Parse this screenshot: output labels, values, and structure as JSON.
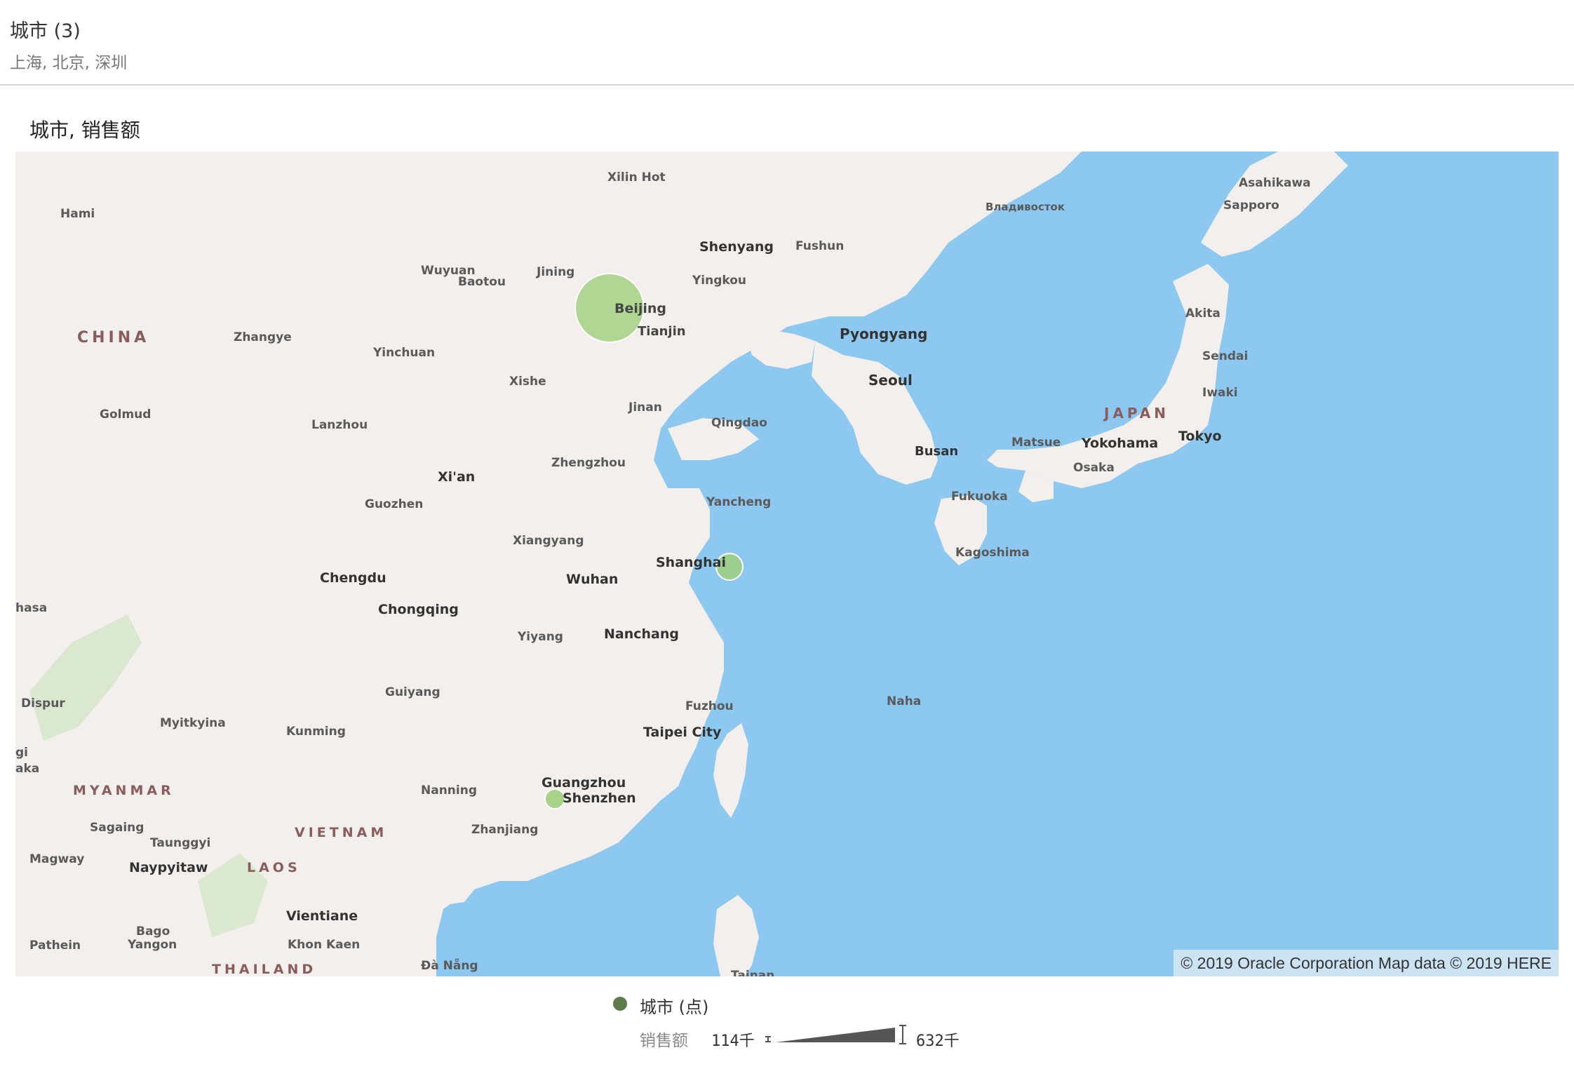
{
  "filter": {
    "title": "城市 (3)",
    "values": "上海, 北京, 深圳"
  },
  "viz": {
    "title": "城市, 销售额"
  },
  "map": {
    "copyright": "© 2019 Oracle Corporation   Map data © 2019 HERE",
    "colors": {
      "water": "#8cc8ef",
      "land": "#f2efec",
      "bubble": "#9fcf7e",
      "bubble_stroke": "#ffffff"
    },
    "bubbles": [
      {
        "city": "北京",
        "map_label": "Beijing",
        "lon": 116.4,
        "lat": 39.9
      },
      {
        "city": "上海",
        "map_label": "Shanghai",
        "lon": 121.5,
        "lat": 31.2
      },
      {
        "city": "深圳",
        "map_label": "Shenzhen",
        "lon": 114.1,
        "lat": 22.5
      }
    ],
    "country_labels": [
      "CHINA",
      "JAPAN",
      "MYANMAR",
      "VIETNAM",
      "LAOS",
      "THAILAND"
    ],
    "city_labels": [
      "Xilin Hot",
      "Hami",
      "Shenyang",
      "Fushun",
      "Владивосток",
      "Asahikawa",
      "Sapporo",
      "Wuyuan",
      "Jining",
      "Baotou",
      "Yingkou",
      "Beijing",
      "Tianjin",
      "Pyongyang",
      "Akita",
      "Zhangye",
      "Yinchuan",
      "Xishe",
      "Seoul",
      "Sendai",
      "Golmud",
      "Jinan",
      "Qingdao",
      "Lanzhou",
      "Iwaki",
      "Matsue",
      "Yokohama",
      "Tokyo",
      "Busan",
      "Osaka",
      "Xi'an",
      "Zhengzhou",
      "Fukuoka",
      "Guozhen",
      "Yancheng",
      "Xiangyang",
      "Kagoshima",
      "Shanghai",
      "Chengdu",
      "Wuhan",
      "hasa",
      "Chongqing",
      "Yiyang",
      "Nanchang",
      "Dispur",
      "Guiyang",
      "Naha",
      "Fuzhou",
      "Myitkyina",
      "Kunming",
      "Taipei City",
      "gi",
      "aka",
      "Guangzhou",
      "Nanning",
      "Shenzhen",
      "Sagaing",
      "Zhanjiang",
      "Taunggyi",
      "Magway",
      "Naypyitaw",
      "Vientiane",
      "Bago",
      "Pathein",
      "Yangon",
      "Khon Kaen",
      "Đà Nẵng",
      "Tainan"
    ]
  },
  "legend": {
    "series_label": "城市 (点)",
    "series_color": "#5f7d4b",
    "metric_label": "销售额",
    "min_label": "114千",
    "max_label": "632千",
    "wedge_color": "#555555"
  }
}
